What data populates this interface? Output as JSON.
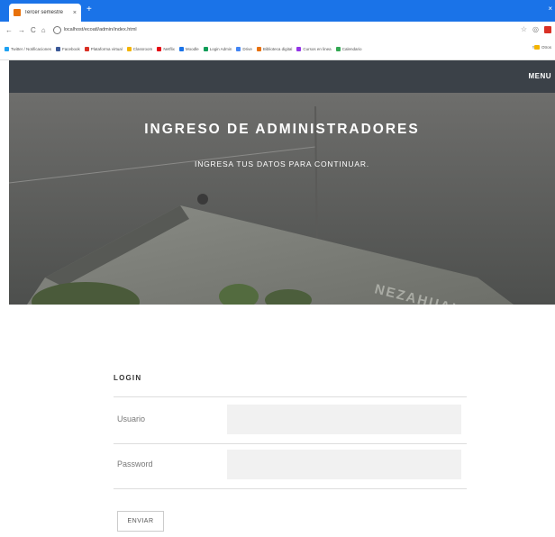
{
  "browser": {
    "tab": {
      "title": "Tercer semestre",
      "close": "×"
    },
    "new_tab": "+",
    "window_close": "×",
    "nav": {
      "back": "←",
      "forward": "→",
      "reload": "C",
      "home": "⌂"
    },
    "url": "localhost/ecoatl/admin/index.html",
    "bookmarks": [
      {
        "label": "Twitter / Notificaciones",
        "color": "#1da1f2"
      },
      {
        "label": "Facebook",
        "color": "#3b5998"
      },
      {
        "label": "Plataforma virtual",
        "color": "#d93025"
      },
      {
        "label": "Classroom",
        "color": "#f4b400"
      },
      {
        "label": "Netflix",
        "color": "#e50914"
      },
      {
        "label": "Moodle",
        "color": "#1a73e8"
      },
      {
        "label": "Login Admin",
        "color": "#0f9d58"
      },
      {
        "label": "Drive",
        "color": "#4285f4"
      },
      {
        "label": "Biblioteca digital",
        "color": "#e8710a"
      },
      {
        "label": "Cursos en linea",
        "color": "#9334e6"
      },
      {
        "label": "Calendario",
        "color": "#34a853"
      }
    ],
    "bookmarks_more": "»",
    "other_bookmarks": "Otros"
  },
  "nav": {
    "menu": "MENU"
  },
  "hero": {
    "title": "INGRESO DE ADMINISTRADORES",
    "subtitle": "INGRESA TUS DATOS PARA CONTINUAR.",
    "building_sign": "NEZAHUAL"
  },
  "login": {
    "heading": "LOGIN",
    "fields": [
      {
        "label": "Usuario",
        "value": ""
      },
      {
        "label": "Password",
        "value": ""
      }
    ],
    "submit": "ENVIAR"
  }
}
